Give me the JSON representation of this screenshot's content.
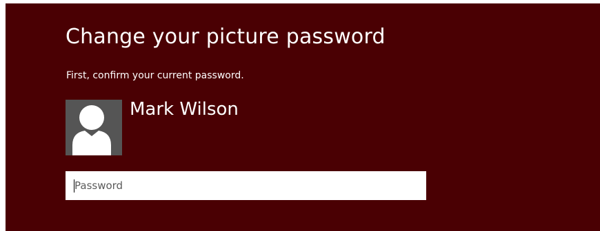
{
  "dialog": {
    "title": "Change your picture password",
    "instruction": "First, confirm your current password.",
    "accent_background": "#4a0003"
  },
  "user": {
    "name": "Mark Wilson",
    "avatar_icon": "user-silhouette-icon"
  },
  "password_field": {
    "placeholder": "Password",
    "value": ""
  }
}
